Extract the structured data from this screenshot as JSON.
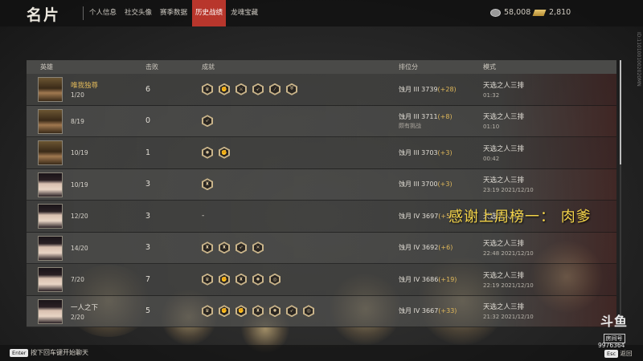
{
  "header": {
    "title": "名片",
    "tabs": [
      {
        "label": "个人信息",
        "active": false
      },
      {
        "label": "社交头像",
        "active": false
      },
      {
        "label": "赛季数据",
        "active": false
      },
      {
        "label": "历史战绩",
        "active": true
      },
      {
        "label": "龙魂宝藏",
        "active": false
      }
    ],
    "silver_amount": "58,008",
    "gold_amount": "2,810",
    "side_id": "ID:1101001002020MN"
  },
  "table": {
    "columns": [
      "英雄",
      "击败",
      "成就",
      "排位分",
      "模式"
    ],
    "rows": [
      {
        "avatar": "hero-male",
        "name": "唯我独尊",
        "rank": "1/20",
        "kills": "6",
        "achievements": [
          "crown-icon",
          "fist-icon",
          "swords-icon",
          "arrow-icon",
          "slash-icon",
          "shield-icon"
        ],
        "tier": "蚀月 III",
        "score": "3739",
        "delta": "(+28)",
        "note": "",
        "mode": "天选之人三排",
        "time": "01:32"
      },
      {
        "avatar": "hero-male",
        "name": "",
        "rank": "8/19",
        "kills": "0",
        "achievements": [
          "arrow-icon"
        ],
        "tier": "蚀月 III",
        "score": "3711",
        "delta": "(+8)",
        "note": "颇有挑战",
        "mode": "天选之人三排",
        "time": "01:10"
      },
      {
        "avatar": "hero-male",
        "name": "",
        "rank": "10/19",
        "kills": "1",
        "achievements": [
          "fire-icon",
          "fist-icon"
        ],
        "tier": "蚀月 III",
        "score": "3703",
        "delta": "(+3)",
        "note": "",
        "mode": "天选之人三排",
        "time": "00:42"
      },
      {
        "avatar": "hero-female",
        "name": "",
        "rank": "10/19",
        "kills": "3",
        "achievements": [
          "helmet-icon"
        ],
        "tier": "蚀月 III",
        "score": "3700",
        "delta": "(+3)",
        "note": "",
        "mode": "天选之人三排",
        "time": "23:19  2021/12/10"
      },
      {
        "avatar": "hero-female",
        "name": "",
        "rank": "12/20",
        "kills": "3",
        "achievements_text": "-",
        "achievements": [],
        "tier": "蚀月 IV",
        "score": "3697",
        "delta": "(+5)",
        "note": "",
        "mode": "天选之人三排",
        "time": ""
      },
      {
        "avatar": "hero-female",
        "name": "",
        "rank": "14/20",
        "kills": "3",
        "achievements": [
          "helmet-icon",
          "helmet-icon",
          "arrow-icon",
          "cross-icon"
        ],
        "tier": "蚀月 IV",
        "score": "3692",
        "delta": "(+6)",
        "note": "",
        "mode": "天选之人三排",
        "time": "22:48  2021/12/10"
      },
      {
        "avatar": "hero-female",
        "name": "",
        "rank": "7/20",
        "kills": "7",
        "achievements": [
          "crown-icon",
          "fist-icon",
          "helmet-icon",
          "fire-icon",
          "target-icon"
        ],
        "tier": "蚀月 IV",
        "score": "3686",
        "delta": "(+19)",
        "note": "",
        "mode": "天选之人三排",
        "time": "22:19  2021/12/10"
      },
      {
        "avatar": "hero-female",
        "name": "一人之下",
        "rank": "2/20",
        "kills": "5",
        "achievements": [
          "crown-icon",
          "fist-icon",
          "fist-icon",
          "helmet-icon",
          "fire-icon",
          "arrow-icon",
          "target-icon"
        ],
        "tier": "蚀月 IV",
        "score": "3667",
        "delta": "(+33)",
        "note": "",
        "mode": "天选之人三排",
        "time": "21:32  2021/12/10"
      }
    ]
  },
  "overlay_text": "感谢上周榜一：  肉爹",
  "footer": {
    "enter_key": "Enter",
    "hint": "按下回车键开始聊天",
    "esc_key": "Esc",
    "esc_label": "返回"
  },
  "watermark": {
    "logo": "斗鱼",
    "room_label": "房间号",
    "room_number": "9976364"
  }
}
